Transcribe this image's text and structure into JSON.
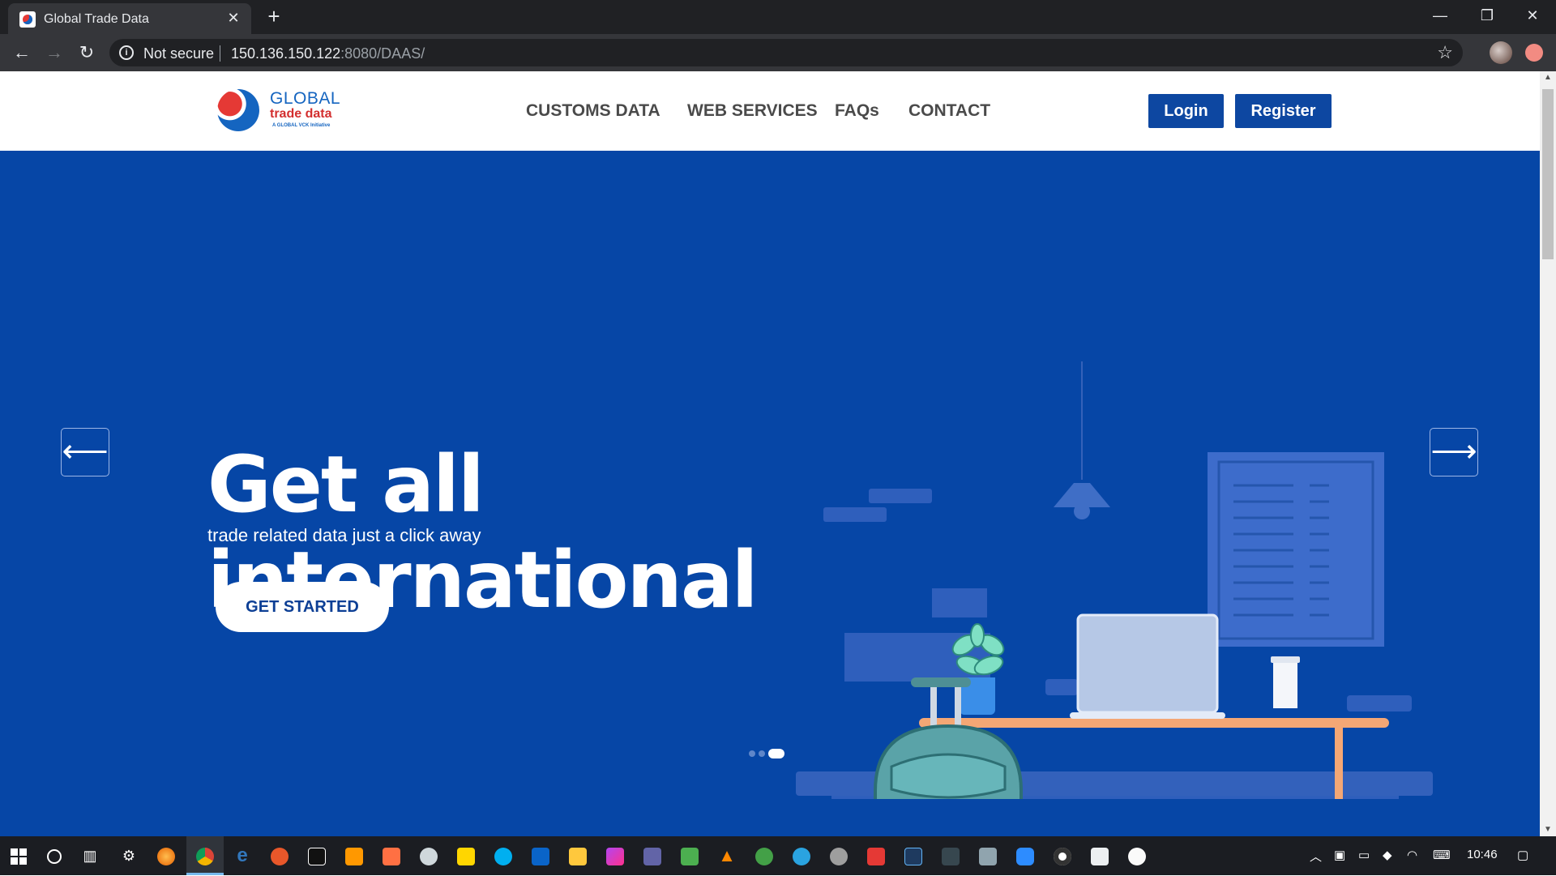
{
  "browser": {
    "tab_title": "Global Trade Data",
    "tab_close": "✕",
    "new_tab": "+",
    "security_label": "Not secure",
    "url_host": "150.136.150.122",
    "url_rest": ":8080/DAAS/",
    "window": {
      "minimize": "—",
      "restore": "❐",
      "close": "✕"
    }
  },
  "site": {
    "logo": {
      "line1": "GLOBAL",
      "line2": "trade data",
      "line3": "A GLOBAL VCK Initiative"
    },
    "nav": [
      "CUSTOMS DATA",
      "WEB SERVICES",
      "FAQs",
      "CONTACT"
    ],
    "login_label": "Login",
    "register_label": "Register"
  },
  "hero": {
    "headline_line1": "Get all",
    "headline_line2": "international",
    "tagline": "trade related data just a click away",
    "cta_label": "GET STARTED",
    "prev_arrow": "⟵",
    "next_arrow": "⟶",
    "slide_count": 3,
    "active_slide": 3
  },
  "taskbar": {
    "clock": "10:46",
    "icons": [
      "windows-start-icon",
      "cortana-icon",
      "task-view-icon",
      "settings-icon",
      "firefox-icon",
      "chrome-icon",
      "edge-icon",
      "app-icon-1",
      "app-icon-2",
      "sublime-icon",
      "app-icon-3",
      "app-icon-4",
      "sticky-notes-icon",
      "skype-icon",
      "outlook-icon",
      "file-explorer-icon",
      "phpstorm-icon",
      "teams-icon",
      "app-icon-5",
      "vlc-icon",
      "app-icon-6",
      "telegram-icon",
      "app-icon-7",
      "app-icon-8",
      "app-icon-9",
      "app-icon-10",
      "app-icon-11",
      "zoom-icon",
      "app-icon-12",
      "app-icon-13",
      "app-icon-14"
    ]
  },
  "colors": {
    "hero_bg": "#0646a6",
    "brand_blue": "#0d47a1",
    "browser_dark": "#202124"
  }
}
